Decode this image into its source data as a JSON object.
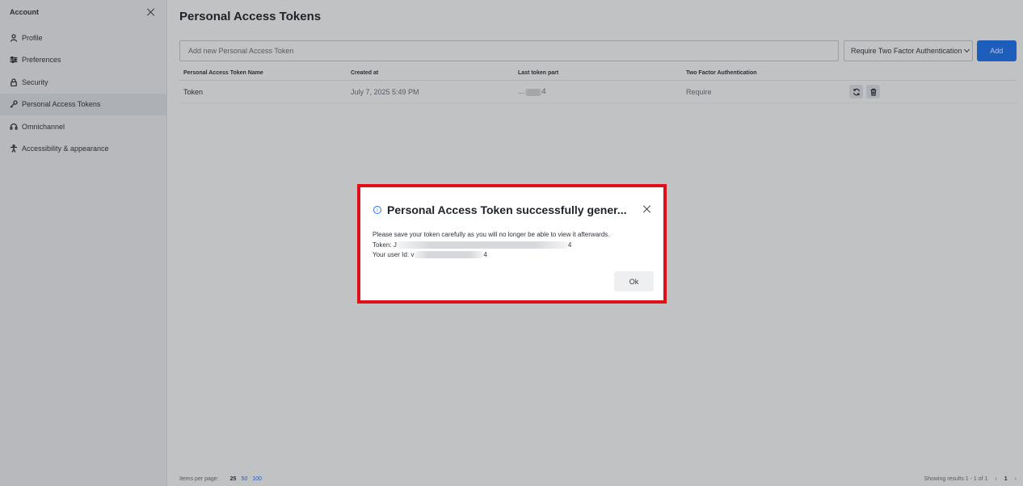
{
  "sidebar": {
    "title": "Account",
    "items": [
      {
        "label": "Profile",
        "icon": "user-icon"
      },
      {
        "label": "Preferences",
        "icon": "sliders-icon"
      },
      {
        "label": "Security",
        "icon": "lock-icon"
      },
      {
        "label": "Personal Access Tokens",
        "icon": "key-icon"
      },
      {
        "label": "Omnichannel",
        "icon": "headset-icon"
      },
      {
        "label": "Accessibility & appearance",
        "icon": "accessibility-icon"
      }
    ]
  },
  "main": {
    "title": "Personal Access Tokens",
    "input_placeholder": "Add new Personal Access Token",
    "tfa_select": "Require Two Factor Authentication",
    "add_label": "Add",
    "columns": [
      "Personal Access Token Name",
      "Created at",
      "Last token part",
      "Two Factor Authentication"
    ],
    "rows": [
      {
        "name": "Token",
        "created": "July 7, 2025 5:49 PM",
        "last_part_prefix": "...",
        "last_part_suffix": "4",
        "tfa": "Require"
      }
    ],
    "footer": {
      "items_per_page": "Items per page:",
      "page_sizes": [
        "25",
        "50",
        "100"
      ],
      "showing": "Showing results 1 - 1 of 1",
      "current_page": "1"
    }
  },
  "modal": {
    "title": "Personal Access Token successfully gener...",
    "message": "Please save your token carefully as you will no longer be able to view it afterwards.",
    "token_label": "Token:",
    "token_prefix": "J",
    "token_suffix": "4",
    "user_id_label": "Your user Id:",
    "user_id_prefix": "v",
    "user_id_suffix": "4",
    "ok_label": "Ok"
  },
  "colors": {
    "primary": "#1d74f5",
    "highlight_border": "#e0101a",
    "sidebar_bg": "#f2f3f5"
  }
}
